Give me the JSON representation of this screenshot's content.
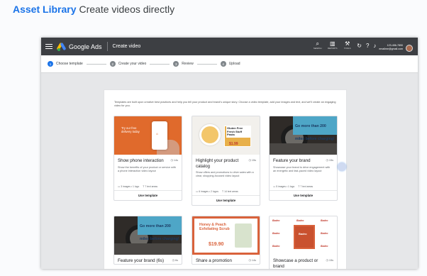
{
  "slide": {
    "title_accent": "Asset Library",
    "title_rest": "Create videos directly"
  },
  "topbar": {
    "brand": "Google Ads",
    "page": "Create video",
    "tools": [
      {
        "icon": "search-icon",
        "label": "SEARCH"
      },
      {
        "icon": "reports-icon",
        "label": "REPORTS"
      },
      {
        "icon": "wrench-icon",
        "label": "TOOLS"
      }
    ],
    "account_id": "123-456-7890",
    "account_email": "emailme@gmail.com"
  },
  "steps": [
    {
      "num": "1",
      "label": "Choose template"
    },
    {
      "num": "2",
      "label": "Create your video"
    },
    {
      "num": "3",
      "label": "Review"
    },
    {
      "num": "4",
      "label": "Upload"
    }
  ],
  "intro": "Templates are built upon creative best practices and help you tell your product and brand's unique story. Choose a video template, add your images and text, and we'll create an engaging video for you.",
  "cards": [
    {
      "title": "Show phone interaction",
      "duration": "14s",
      "desc": "Show the benefits of your product or service with a phone interaction video layout",
      "meta1": "3 images • 1 logo",
      "meta2": "7 text areas",
      "use": "Use template",
      "thumb": {
        "text": "Try our free delivery today"
      }
    },
    {
      "title": "Highlight your product catalog",
      "duration": "15s",
      "desc": "Show offers and promotions to drive sales with a clear, shopping-focused video layout",
      "meta1": "6 images • 2 logos",
      "meta2": "14 text areas",
      "use": "Use template",
      "thumb": {
        "text": "Gluten Free Fresh Stuff Pasta",
        "price": "$1.99"
      }
    },
    {
      "title": "Feature your brand",
      "duration": "15s",
      "desc": "Showcase your brand to drive engagement with an energetic and fast-paced video layout",
      "meta1": "5 images • 1 logo",
      "meta2": "7 text areas",
      "use": "Use template",
      "thumb": {
        "text": "Go more than 200 miles before charging!"
      }
    },
    {
      "title": "Feature your brand (6s)",
      "duration": "6s",
      "thumb": {
        "text": "Go more than 200 miles before charging!"
      }
    },
    {
      "title": "Share a promotion",
      "duration": "14s",
      "thumb": {
        "text": "Honey & Peach Exfoliating Scrub",
        "price": "$19.90"
      }
    },
    {
      "title": "Showcase a product or brand",
      "duration": "15s",
      "thumb": {
        "text": "Badro"
      }
    }
  ]
}
